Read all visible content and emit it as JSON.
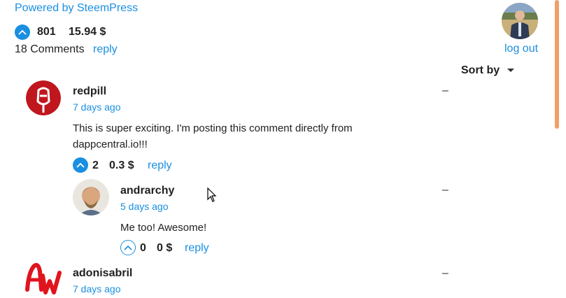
{
  "header": {
    "powered_by": "Powered by SteemPress",
    "post_votes": "801",
    "post_payout": "15.94 $",
    "comments_count": "18 Comments",
    "reply_label": "reply",
    "logout_label": "log out",
    "sort_label": "Sort by"
  },
  "comments": [
    {
      "author": "redpill",
      "time": "7 days ago",
      "body": "This is super exciting. I'm posting this comment directly from dappcentral.io!!!",
      "votes": "2",
      "payout": "0.3 $",
      "reply_label": "reply",
      "collapse": "–"
    },
    {
      "author": "andrarchy",
      "time": "5 days ago",
      "body": "Me too! Awesome!",
      "votes": "0",
      "payout": "0 $",
      "reply_label": "reply",
      "collapse": "–"
    },
    {
      "author": "adonisabril",
      "time": "7 days ago",
      "collapse": "–"
    }
  ],
  "colors": {
    "accent": "#1a8fe0",
    "redpill_avatar": "#c0161d",
    "aw_logo": "#e0141e",
    "scroll_accent": "#f0a06a"
  }
}
